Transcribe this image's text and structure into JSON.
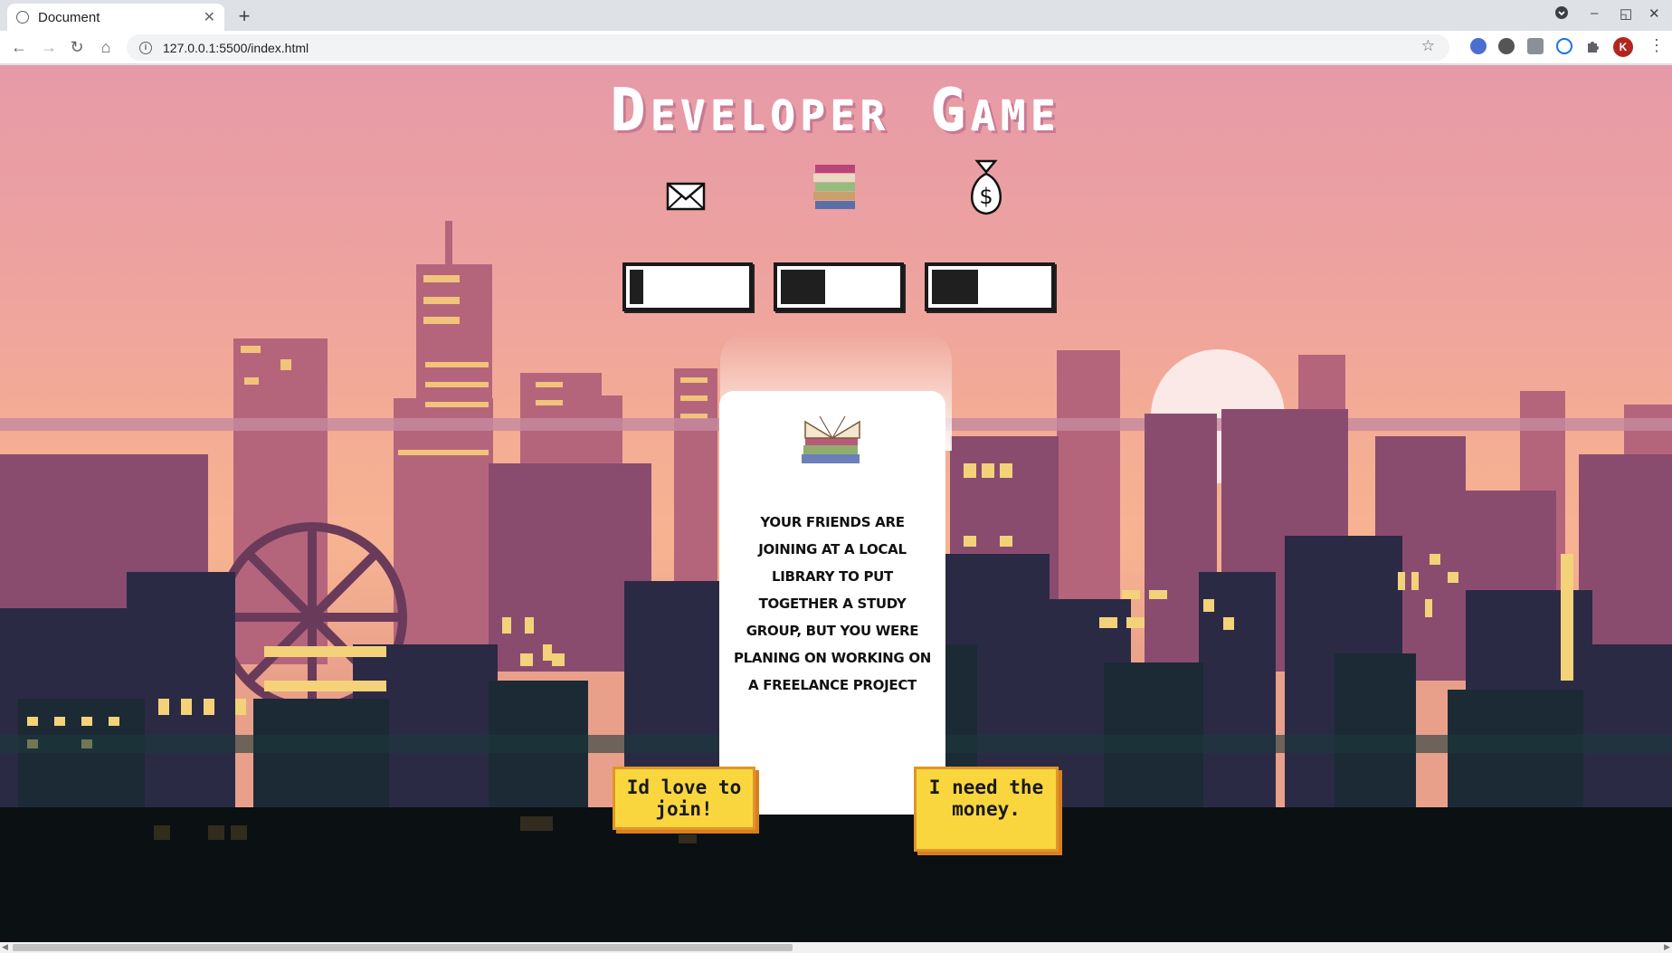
{
  "browser": {
    "tab_title": "Document",
    "tab_close": "✕",
    "new_tab": "+",
    "url": "127.0.0.1:5500/index.html",
    "avatar_letter": "K",
    "window_controls": [
      "–",
      "◱",
      "✕"
    ]
  },
  "game": {
    "title": "Developer Game",
    "stats": [
      {
        "name": "social",
        "icon": "envelope-icon",
        "level": 0.12
      },
      {
        "name": "knowledge",
        "icon": "books-icon",
        "level": 0.38
      },
      {
        "name": "money",
        "icon": "money-bag-icon",
        "level": 0.4
      }
    ],
    "card": {
      "icon": "open-book-stack-icon",
      "text": "Your friends are joining at a local library to put together a study group, but you were planing on working on a freelance project"
    },
    "choices": {
      "left": "Id love to join!",
      "right": "I need the money."
    }
  },
  "colors": {
    "sky_top": "#e69aa8",
    "sky_bottom": "#f6b391",
    "button_yellow": "#f9d63e",
    "button_border": "#e0952a"
  }
}
